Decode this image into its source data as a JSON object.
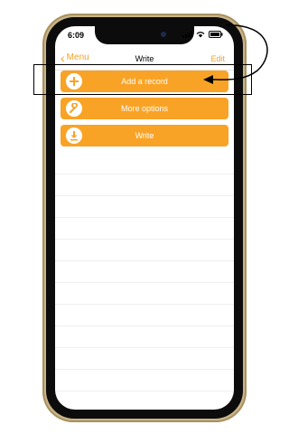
{
  "status_bar": {
    "time": "6:09"
  },
  "nav": {
    "back_label": "Menu",
    "title": "Write",
    "edit_label": "Edit"
  },
  "rows": [
    {
      "label": "Add a record",
      "icon": "plus-icon"
    },
    {
      "label": "More options",
      "icon": "wrench-icon"
    },
    {
      "label": "Write",
      "icon": "download-icon"
    }
  ],
  "colors": {
    "accent": "#f9a326",
    "frame": "#c9b48a"
  }
}
